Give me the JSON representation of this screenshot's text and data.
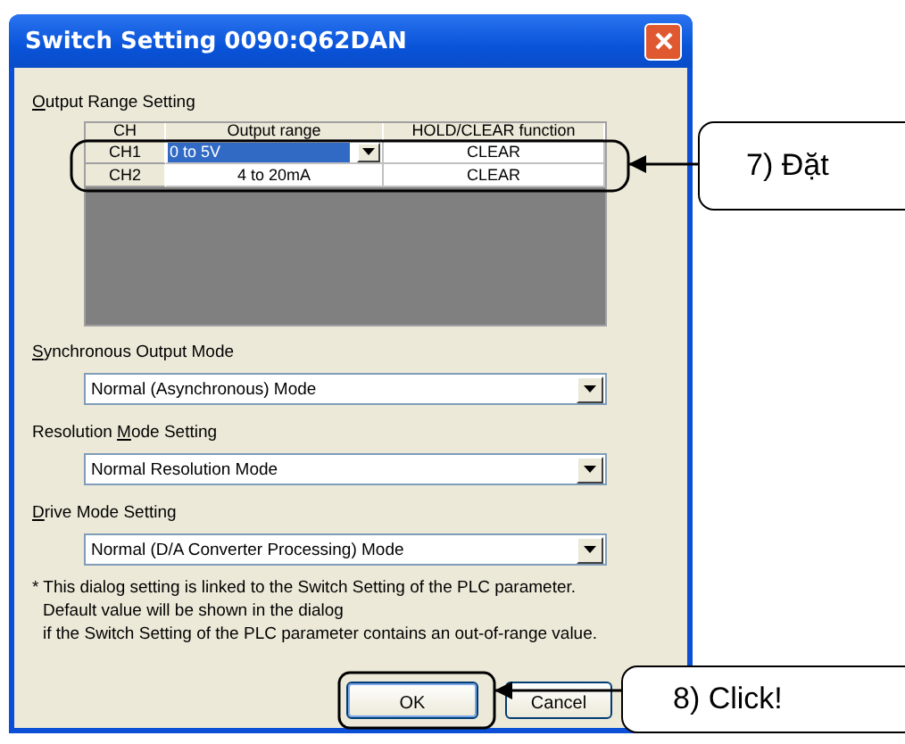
{
  "window": {
    "title": "Switch Setting 0090:Q62DAN"
  },
  "output_range": {
    "label": {
      "key": "O",
      "post": "utput Range Setting"
    },
    "columns": [
      "CH",
      "Output range",
      "HOLD/CLEAR function"
    ],
    "rows": [
      {
        "ch": "CH1",
        "output_range": "0 to 5V",
        "hold_clear": "CLEAR",
        "selected": true
      },
      {
        "ch": "CH2",
        "output_range": "4 to 20mA",
        "hold_clear": "CLEAR",
        "selected": false
      }
    ]
  },
  "settings": [
    {
      "label": {
        "key": "S",
        "post": "ynchronous Output Mode"
      },
      "value": "Normal (Asynchronous) Mode"
    },
    {
      "label": {
        "pre": "Resolution ",
        "key": "M",
        "post": "ode Setting"
      },
      "value": "Normal Resolution Mode"
    },
    {
      "label": {
        "key": "D",
        "post": "rive Mode Setting"
      },
      "value": "Normal (D/A Converter Processing) Mode"
    }
  ],
  "note": [
    "* This dialog setting is linked to the Switch Setting of the PLC parameter.",
    "Default value will be shown in the dialog",
    "if the Switch Setting of the PLC parameter contains an out-of-range value."
  ],
  "buttons": [
    {
      "label": "OK",
      "default": true
    },
    {
      "label": "Cancel",
      "default": false
    }
  ],
  "annotations": [
    {
      "text": "7) Đặt"
    },
    {
      "text": "8) Click!"
    }
  ]
}
